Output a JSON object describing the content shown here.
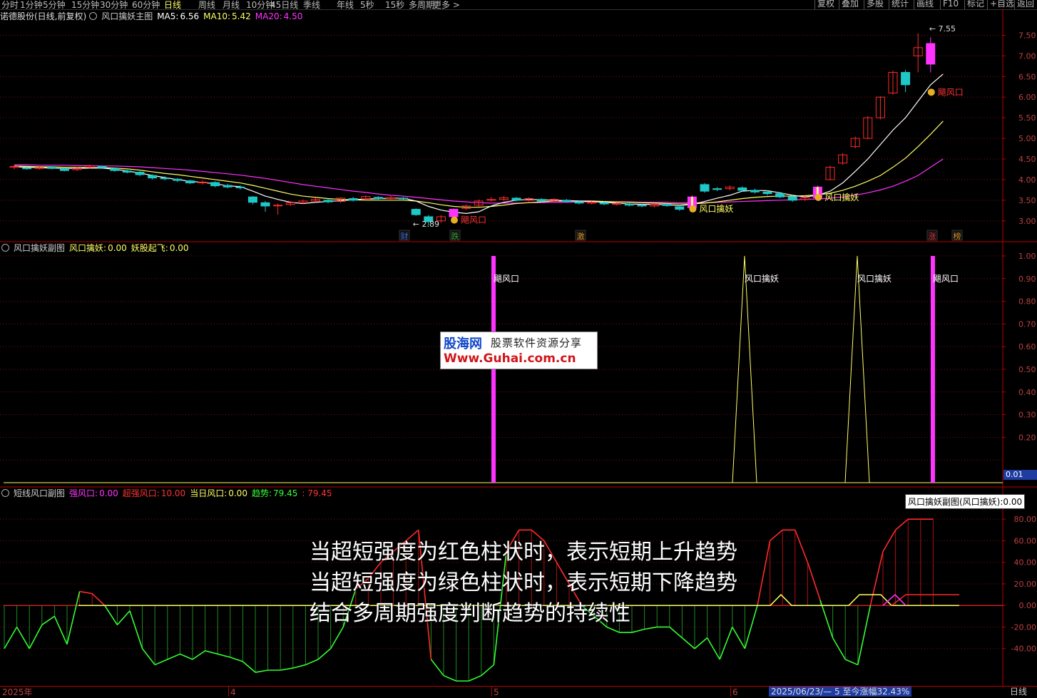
{
  "toolbar": {
    "left": [
      "分时",
      "1分钟",
      "5分钟",
      "15分钟",
      "30分钟",
      "60分钟",
      "日线",
      "周线",
      "月线",
      "10分钟",
      "45日线",
      "季线",
      "年线",
      "5秒",
      "15秒",
      "多周期",
      "更多 >"
    ],
    "active": "日线",
    "right": [
      "复权",
      "叠加",
      "多股",
      "统计",
      "画线",
      "F10",
      "标记",
      "+自选",
      "返回"
    ]
  },
  "main_panel": {
    "stock": "诺德股份(日线,前复权)",
    "formula": "风口擒妖主图",
    "ma5_label": "MA5:",
    "ma5_value": "6.56",
    "ma10_label": "MA10:",
    "ma10_value": "5.42",
    "ma20_label": "MA20:",
    "ma20_value": "4.50",
    "high_label": "7.55",
    "low_label": "2.89",
    "signal_labels": [
      "飓风口",
      "风口擒妖",
      "风口擒妖",
      "飓风口"
    ],
    "event_tags": [
      "财",
      "跌",
      "激",
      "涨",
      "榜"
    ],
    "y_ticks": [
      "7.50",
      "7.00",
      "6.50",
      "6.00",
      "5.50",
      "5.00",
      "4.50",
      "4.00",
      "3.50",
      "3.00"
    ]
  },
  "sub_panel_1": {
    "title": "风口擒妖副图",
    "v1_label": "风口擒妖:",
    "v1_value": "0.00",
    "v2_label": "妖股起飞:",
    "v2_value": "0.00",
    "bar_labels": [
      "飓风口",
      "风口擒妖",
      "风口擒妖",
      "飓风口"
    ],
    "y_ticks": [
      "1.00",
      "0.90",
      "0.80",
      "0.70",
      "0.60",
      "0.50",
      "0.40",
      "0.30",
      "0.20"
    ],
    "value_box": "0.01"
  },
  "sub_panel_2": {
    "title": "短线风口副图",
    "v1_label": "强风口:",
    "v1_value": "0.00",
    "v2_label": "超强风口:",
    "v2_value": "10.00",
    "v3_label": "当日风口:",
    "v3_value": "0.00",
    "v4_label": "趋势:",
    "v4_value": "79.45",
    "v4_value2": ": 79.45",
    "y_ticks": [
      "80.00",
      "60.00",
      "40.00",
      "20.00",
      "0.00",
      "-20.00",
      "-40.00"
    ],
    "tooltip": "风口擒妖副图(风口擒妖):0.00"
  },
  "captions": [
    "当超短强度为红色柱状时，表示短期上升趋势",
    "当超短强度为绿色柱状时，表示短期下降趋势",
    "结合多周期强度判断趋势的持续性"
  ],
  "watermark": {
    "brand": "股海网",
    "slogan": "股票软件资源分享",
    "url": "Www.Guhai.com.cn"
  },
  "bottom": {
    "dates": [
      "2025年",
      "4",
      "5",
      "6"
    ],
    "status": "2025/06/23/— 5 至今涨幅32.43%",
    "period": "日线"
  },
  "colors": {
    "up": "#ff2a2a",
    "down": "#1fc8c8",
    "ma5": "#ffffff",
    "ma10": "#ffff66",
    "ma20": "#ff33ff",
    "signal": "#ff33ff",
    "signal2": "#ffff66",
    "trend_up": "#ff2a2a",
    "trend_down": "#33ff33",
    "grid": "#7a1010"
  },
  "chart_data": [
    {
      "type": "candlestick",
      "note_xlabel": "",
      "ylabel": "",
      "ylim": [
        2.65,
        7.75
      ],
      "candles": [
        [
          4.3,
          4.32,
          4.35,
          4.25
        ],
        [
          4.28,
          4.27,
          4.31,
          4.24
        ],
        [
          4.27,
          4.29,
          4.33,
          4.24
        ],
        [
          4.3,
          4.27,
          4.32,
          4.25
        ],
        [
          4.26,
          4.22,
          4.29,
          4.2
        ],
        [
          4.24,
          4.28,
          4.31,
          4.21
        ],
        [
          4.3,
          4.33,
          4.36,
          4.26
        ],
        [
          4.32,
          4.29,
          4.34,
          4.26
        ],
        [
          4.27,
          4.22,
          4.29,
          4.19
        ],
        [
          4.21,
          4.18,
          4.24,
          4.15
        ],
        [
          4.18,
          4.12,
          4.2,
          4.08
        ],
        [
          4.1,
          4.04,
          4.13,
          4.0
        ],
        [
          4.04,
          4.02,
          4.08,
          3.98
        ],
        [
          4.01,
          3.98,
          4.04,
          3.94
        ],
        [
          3.97,
          3.92,
          4.0,
          3.89
        ],
        [
          3.92,
          3.94,
          3.98,
          3.88
        ],
        [
          3.93,
          3.85,
          3.96,
          3.81
        ],
        [
          3.86,
          3.82,
          3.9,
          3.79
        ],
        [
          3.82,
          3.8,
          3.86,
          3.76
        ],
        [
          3.58,
          3.45,
          3.6,
          3.4
        ],
        [
          3.44,
          3.36,
          3.48,
          3.22
        ],
        [
          3.37,
          3.38,
          3.42,
          3.15
        ],
        [
          3.4,
          3.44,
          3.48,
          3.36
        ],
        [
          3.44,
          3.48,
          3.52,
          3.41
        ],
        [
          3.48,
          3.52,
          3.56,
          3.45
        ],
        [
          3.5,
          3.46,
          3.54,
          3.43
        ],
        [
          3.47,
          3.55,
          3.57,
          3.44
        ],
        [
          3.54,
          3.5,
          3.58,
          3.47
        ],
        [
          3.53,
          3.59,
          3.62,
          3.5
        ],
        [
          3.57,
          3.54,
          3.6,
          3.5
        ],
        [
          3.55,
          3.56,
          3.6,
          3.52
        ],
        [
          3.55,
          3.54,
          3.58,
          3.51
        ],
        [
          3.28,
          3.15,
          3.3,
          3.12
        ],
        [
          3.1,
          2.98,
          3.14,
          2.89
        ],
        [
          3.0,
          3.1,
          3.14,
          2.95
        ],
        [
          3.1,
          3.28,
          3.3,
          3.06
        ],
        [
          3.3,
          3.36,
          3.4,
          3.26
        ],
        [
          3.38,
          3.48,
          3.52,
          3.34
        ],
        [
          3.5,
          3.52,
          3.58,
          3.47
        ],
        [
          3.52,
          3.56,
          3.6,
          3.49
        ],
        [
          3.55,
          3.5,
          3.58,
          3.47
        ],
        [
          3.5,
          3.54,
          3.57,
          3.47
        ],
        [
          3.52,
          3.48,
          3.55,
          3.45
        ],
        [
          3.48,
          3.52,
          3.55,
          3.46
        ],
        [
          3.5,
          3.47,
          3.53,
          3.44
        ],
        [
          3.46,
          3.43,
          3.5,
          3.4
        ],
        [
          3.43,
          3.45,
          3.48,
          3.4
        ],
        [
          3.44,
          3.41,
          3.47,
          3.38
        ],
        [
          3.4,
          3.42,
          3.45,
          3.37
        ],
        [
          3.41,
          3.38,
          3.44,
          3.35
        ],
        [
          3.38,
          3.36,
          3.42,
          3.33
        ],
        [
          3.36,
          3.4,
          3.43,
          3.33
        ],
        [
          3.4,
          3.37,
          3.42,
          3.34
        ],
        [
          3.34,
          3.28,
          3.38,
          3.24
        ],
        [
          3.32,
          3.58,
          3.62,
          3.3
        ],
        [
          3.88,
          3.72,
          3.92,
          3.68
        ],
        [
          3.78,
          3.76,
          3.82,
          3.72
        ],
        [
          3.78,
          3.82,
          3.86,
          3.74
        ],
        [
          3.8,
          3.74,
          3.84,
          3.71
        ],
        [
          3.74,
          3.7,
          3.78,
          3.66
        ],
        [
          3.7,
          3.66,
          3.74,
          3.62
        ],
        [
          3.66,
          3.58,
          3.7,
          3.55
        ],
        [
          3.58,
          3.5,
          3.64,
          3.46
        ],
        [
          3.52,
          3.56,
          3.6,
          3.48
        ],
        [
          3.56,
          3.82,
          3.86,
          3.55
        ],
        [
          4.0,
          4.3,
          4.34,
          3.98
        ],
        [
          4.4,
          4.6,
          4.64,
          4.36
        ],
        [
          4.8,
          5.0,
          5.04,
          4.76
        ],
        [
          5.0,
          5.5,
          5.54,
          4.98
        ],
        [
          5.5,
          6.0,
          6.02,
          5.46
        ],
        [
          6.1,
          6.6,
          6.64,
          6.06
        ],
        [
          6.6,
          6.3,
          6.66,
          6.12
        ],
        [
          7.0,
          7.2,
          7.55,
          6.6
        ],
        [
          7.3,
          6.8,
          7.45,
          6.6
        ]
      ],
      "ma5": [
        4.31,
        4.3,
        4.29,
        4.28,
        4.27,
        4.27,
        4.28,
        4.28,
        4.25,
        4.21,
        4.16,
        4.1,
        4.05,
        4.0,
        3.96,
        3.93,
        3.9,
        3.85,
        3.83,
        3.72,
        3.6,
        3.52,
        3.45,
        3.42,
        3.45,
        3.47,
        3.49,
        3.51,
        3.53,
        3.54,
        3.55,
        3.55,
        3.48,
        3.35,
        3.26,
        3.21,
        3.18,
        3.22,
        3.36,
        3.45,
        3.5,
        3.52,
        3.51,
        3.5,
        3.49,
        3.48,
        3.47,
        3.45,
        3.43,
        3.41,
        3.4,
        3.4,
        3.39,
        3.37,
        3.4,
        3.47,
        3.55,
        3.62,
        3.72,
        3.74,
        3.73,
        3.68,
        3.62,
        3.58,
        3.62,
        3.72,
        3.92,
        4.2,
        4.5,
        4.85,
        5.2,
        5.5,
        5.9,
        6.3,
        6.56
      ],
      "ma10": [
        4.33,
        4.32,
        4.31,
        4.31,
        4.3,
        4.3,
        4.29,
        4.29,
        4.28,
        4.26,
        4.23,
        4.19,
        4.15,
        4.12,
        4.08,
        4.04,
        4.0,
        3.96,
        3.92,
        3.86,
        3.79,
        3.72,
        3.65,
        3.6,
        3.57,
        3.54,
        3.52,
        3.51,
        3.5,
        3.5,
        3.5,
        3.5,
        3.48,
        3.44,
        3.39,
        3.35,
        3.33,
        3.33,
        3.35,
        3.38,
        3.42,
        3.44,
        3.46,
        3.48,
        3.48,
        3.48,
        3.48,
        3.47,
        3.46,
        3.45,
        3.44,
        3.43,
        3.42,
        3.41,
        3.41,
        3.43,
        3.46,
        3.5,
        3.54,
        3.57,
        3.59,
        3.6,
        3.6,
        3.61,
        3.63,
        3.67,
        3.74,
        3.84,
        3.96,
        4.1,
        4.3,
        4.52,
        4.8,
        5.1,
        5.42
      ],
      "ma20": [
        4.36,
        4.36,
        4.35,
        4.35,
        4.35,
        4.34,
        4.34,
        4.33,
        4.33,
        4.32,
        4.31,
        4.29,
        4.27,
        4.25,
        4.23,
        4.2,
        4.17,
        4.14,
        4.11,
        4.07,
        4.03,
        3.98,
        3.93,
        3.88,
        3.84,
        3.8,
        3.76,
        3.72,
        3.69,
        3.65,
        3.62,
        3.6,
        3.57,
        3.54,
        3.51,
        3.48,
        3.46,
        3.44,
        3.43,
        3.43,
        3.43,
        3.44,
        3.44,
        3.45,
        3.45,
        3.46,
        3.46,
        3.46,
        3.46,
        3.46,
        3.45,
        3.45,
        3.45,
        3.44,
        3.44,
        3.44,
        3.45,
        3.46,
        3.47,
        3.48,
        3.49,
        3.5,
        3.51,
        3.52,
        3.53,
        3.55,
        3.58,
        3.62,
        3.68,
        3.75,
        3.84,
        3.96,
        4.1,
        4.3,
        4.5
      ]
    },
    {
      "type": "bar",
      "ylim": [
        0,
        1.05
      ],
      "signals": [
        {
          "index": 35,
          "value": 1,
          "style": "bar"
        },
        {
          "index": 54,
          "value": 1,
          "style": "spike"
        },
        {
          "index": 64,
          "value": 1,
          "style": "spike"
        },
        {
          "index": 73,
          "value": 1,
          "style": "bar"
        }
      ]
    },
    {
      "type": "line",
      "ylim": [
        -60,
        92
      ],
      "trend": [
        -40,
        -20,
        -40,
        -18,
        -10,
        -36,
        13,
        11,
        0,
        -18,
        -5,
        -40,
        -55,
        -50,
        -45,
        -50,
        -42,
        -45,
        -48,
        -52,
        -62,
        -60,
        -60,
        -58,
        -55,
        -50,
        -40,
        -20,
        15,
        25,
        40,
        50,
        60,
        70,
        -50,
        -65,
        -70,
        -70,
        -65,
        -55,
        50,
        70,
        70,
        60,
        40,
        20,
        0,
        -10,
        -20,
        -25,
        -25,
        -22,
        -20,
        -20,
        -30,
        -40,
        -30,
        -50,
        -20,
        -40,
        0,
        60,
        70,
        70,
        40,
        5,
        -30,
        -50,
        -55,
        0,
        50,
        70,
        80,
        80,
        80
      ],
      "strong": [
        0,
        0,
        0,
        0,
        0,
        0,
        0,
        0,
        0,
        0,
        0,
        0,
        0,
        0,
        0,
        0,
        0,
        0,
        0,
        0,
        0,
        0,
        0,
        0,
        0,
        0,
        0,
        0,
        0,
        0,
        0,
        0,
        0,
        0,
        0,
        0,
        0,
        0,
        0,
        0,
        0,
        0,
        0,
        0,
        0,
        0,
        0,
        0,
        0,
        0,
        0,
        0,
        0,
        0,
        0,
        0,
        0,
        0,
        0,
        0,
        0,
        0,
        0,
        0,
        0,
        0,
        0,
        0,
        0,
        0,
        0,
        0,
        0,
        0,
        0
      ],
      "super_strong": [
        0,
        0,
        0,
        0,
        0,
        0,
        0,
        0,
        0,
        0,
        0,
        0,
        0,
        0,
        0,
        0,
        0,
        0,
        0,
        0,
        0,
        0,
        0,
        0,
        0,
        0,
        0,
        0,
        0,
        0,
        0,
        0,
        0,
        0,
        0,
        0,
        0,
        0,
        0,
        0,
        0,
        0,
        0,
        0,
        0,
        0,
        0,
        0,
        0,
        0,
        0,
        0,
        0,
        0,
        0,
        0,
        0,
        0,
        0,
        0,
        0,
        0,
        0,
        0,
        0,
        0,
        0,
        0,
        0,
        0,
        0,
        10,
        10,
        10,
        10
      ]
    }
  ]
}
